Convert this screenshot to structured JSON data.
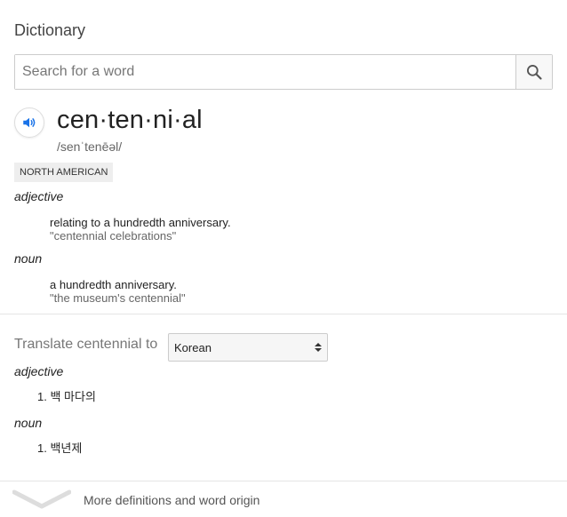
{
  "header": {
    "title": "Dictionary"
  },
  "search": {
    "placeholder": "Search for a word",
    "icon": "search-icon"
  },
  "entry": {
    "speaker_icon": "speaker-icon",
    "headword": "cen·ten·ni·al",
    "phonetic": "/senˈtenēəl/",
    "region": "NORTH AMERICAN",
    "senses": [
      {
        "pos": "adjective",
        "definition": "relating to a hundredth anniversary.",
        "example": "\"centennial celebrations\""
      },
      {
        "pos": "noun",
        "definition": "a hundredth anniversary.",
        "example": "\"the museum's centennial\""
      }
    ]
  },
  "translate": {
    "label": "Translate centennial to",
    "selected_language": "Korean",
    "groups": [
      {
        "pos": "adjective",
        "items": [
          "1. 백 마다의"
        ]
      },
      {
        "pos": "noun",
        "items": [
          "1. 백년제"
        ]
      }
    ]
  },
  "footer": {
    "more_label": "More definitions and word origin",
    "icon": "chevron-down-icon"
  },
  "colors": {
    "accent": "#1a73e8",
    "muted": "#777777",
    "divider": "#e5e5e5"
  }
}
